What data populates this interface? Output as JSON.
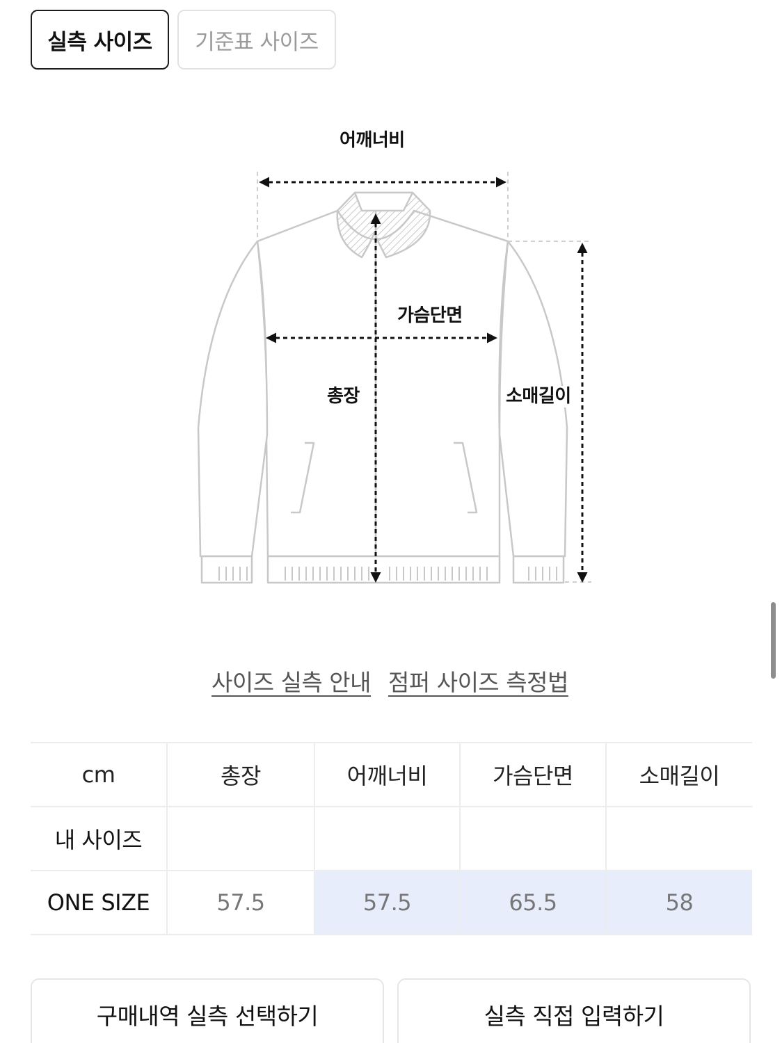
{
  "tabs": {
    "actual_label": "실측 사이즈",
    "standard_label": "기준표 사이즈"
  },
  "diagram": {
    "shoulder_label": "어깨너비",
    "chest_label": "가슴단면",
    "length_label": "총장",
    "sleeve_label": "소매길이",
    "colors": {
      "garment": "#c8c8c8",
      "arrows": "#111111"
    }
  },
  "links": {
    "size_guide": "사이즈 실측 안내",
    "jumper_method": "점퍼 사이즈 측정법"
  },
  "table": {
    "headers": [
      "cm",
      "총장",
      "어깨너비",
      "가슴단면",
      "소매길이"
    ],
    "my_size_label": "내 사이즈",
    "rows": [
      {
        "label": "ONE SIZE",
        "values": [
          "57.5",
          "57.5",
          "65.5",
          "58"
        ]
      }
    ],
    "highlight_color": "#e8edfc"
  },
  "buttons": {
    "purchase_history": "구매내역 실측 선택하기",
    "manual_input": "실측 직접 입력하기"
  }
}
